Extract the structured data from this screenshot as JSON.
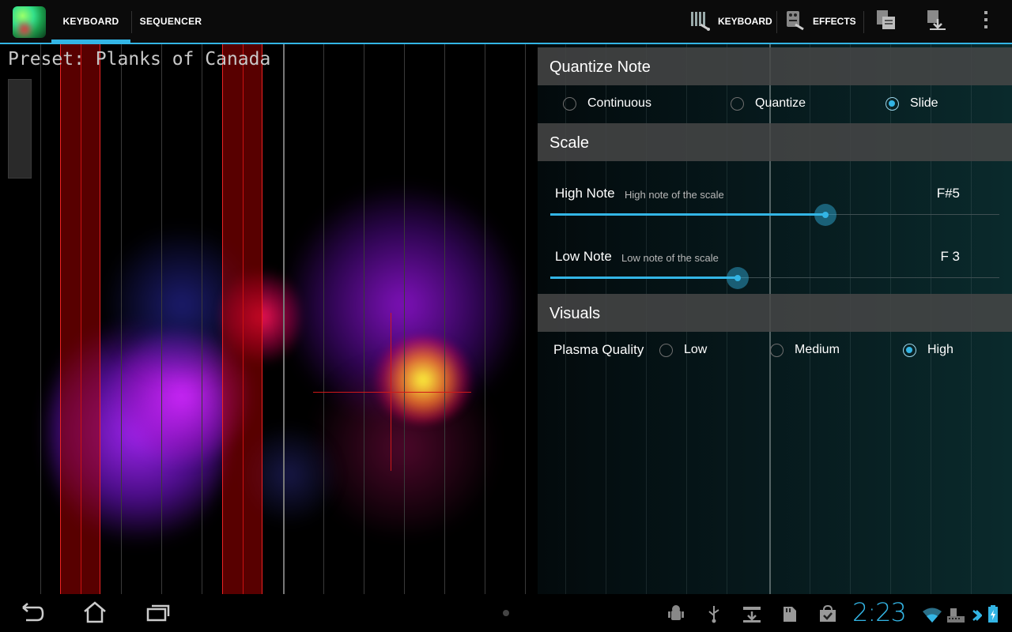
{
  "actionbar": {
    "tabs": [
      {
        "label": "KEYBOARD",
        "active": true
      },
      {
        "label": "SEQUENCER",
        "active": false
      }
    ],
    "actions": [
      {
        "label": "KEYBOARD",
        "icon": "keyboard-settings-icon"
      },
      {
        "label": "EFFECTS",
        "icon": "effects-settings-icon"
      }
    ],
    "icons": [
      "save-preset-icon",
      "load-preset-icon",
      "overflow-menu-icon"
    ],
    "accent": "#33b5e5"
  },
  "canvas": {
    "preset_label": "Preset: Planks of Canada"
  },
  "settings": {
    "quantize": {
      "header": "Quantize Note",
      "options": [
        "Continuous",
        "Quantize",
        "Slide"
      ],
      "selected": "Slide"
    },
    "scale": {
      "header": "Scale",
      "high_note": {
        "title": "High Note",
        "summary": "High note of the scale",
        "value": "F#5",
        "slider_fraction": 0.6
      },
      "low_note": {
        "title": "Low Note",
        "summary": "Low note of the scale",
        "value": "F 3",
        "slider_fraction": 0.42
      }
    },
    "visuals": {
      "header": "Visuals",
      "plasma_quality_label": "Plasma Quality",
      "options": [
        "Low",
        "Medium",
        "High"
      ],
      "selected": "High"
    }
  },
  "systembar": {
    "clock": "2:23",
    "nav_icons": [
      "back-icon",
      "home-icon",
      "recent-apps-icon"
    ],
    "status_icons": [
      "android-debug-icon",
      "usb-icon",
      "download-icon",
      "sd-card-icon",
      "market-icon",
      "wifi-icon",
      "keyboard-icon",
      "bluetooth-icon",
      "battery-icon"
    ]
  }
}
